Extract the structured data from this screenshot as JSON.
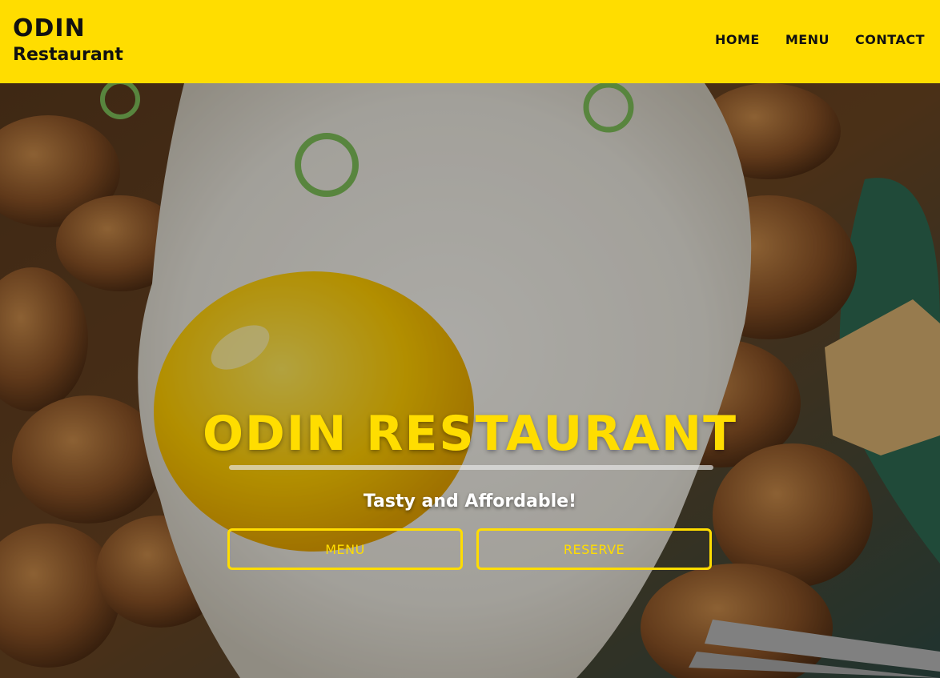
{
  "header": {
    "brand_title": "ODIN",
    "brand_subtitle": "Restaurant",
    "nav": [
      {
        "label": "HOME"
      },
      {
        "label": "MENU"
      },
      {
        "label": "CONTACT"
      }
    ]
  },
  "hero": {
    "title": "ODIN RESTAURANT",
    "tagline": "Tasty and Affordable!",
    "buttons": [
      {
        "label": "MENU"
      },
      {
        "label": "RESERVE"
      }
    ]
  },
  "colors": {
    "accent": "#FFDD00",
    "header_text": "#111111",
    "tagline_text": "#FFFFFF"
  }
}
